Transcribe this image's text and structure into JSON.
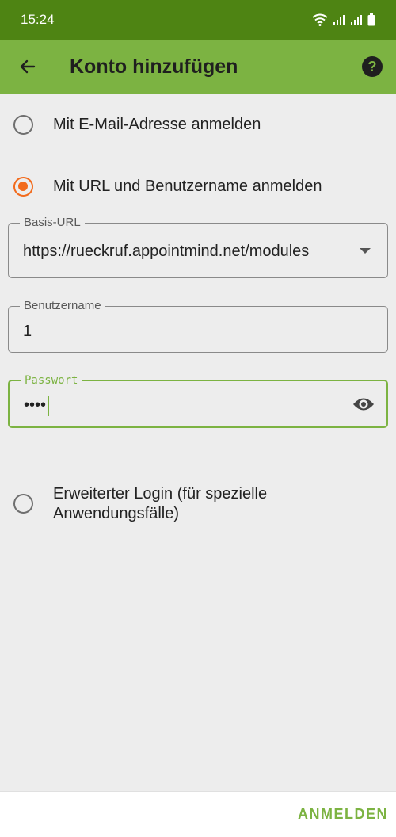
{
  "statusbar": {
    "time": "15:24"
  },
  "appbar": {
    "title": "Konto hinzufügen"
  },
  "options": {
    "email_label": "Mit E-Mail-Adresse anmelden",
    "url_label": "Mit URL und Benutzername anmelden",
    "advanced_label_line1": "Erweiterter Login (für spezielle",
    "advanced_label_line2": "Anwendungsfälle)",
    "selected": "url"
  },
  "fields": {
    "base_url_label": "Basis-URL",
    "base_url_value": "https://rueckruf.appointmind.net/modules",
    "username_label": "Benutzername",
    "username_value": "1",
    "password_label": "Passwort",
    "password_value": "••••"
  },
  "footer": {
    "login_label": "ANMELDEN"
  },
  "colors": {
    "statusbar": "#4e8413",
    "appbar": "#7cb342",
    "accent": "#7cb342",
    "radio_checked": "#f26b1d"
  }
}
